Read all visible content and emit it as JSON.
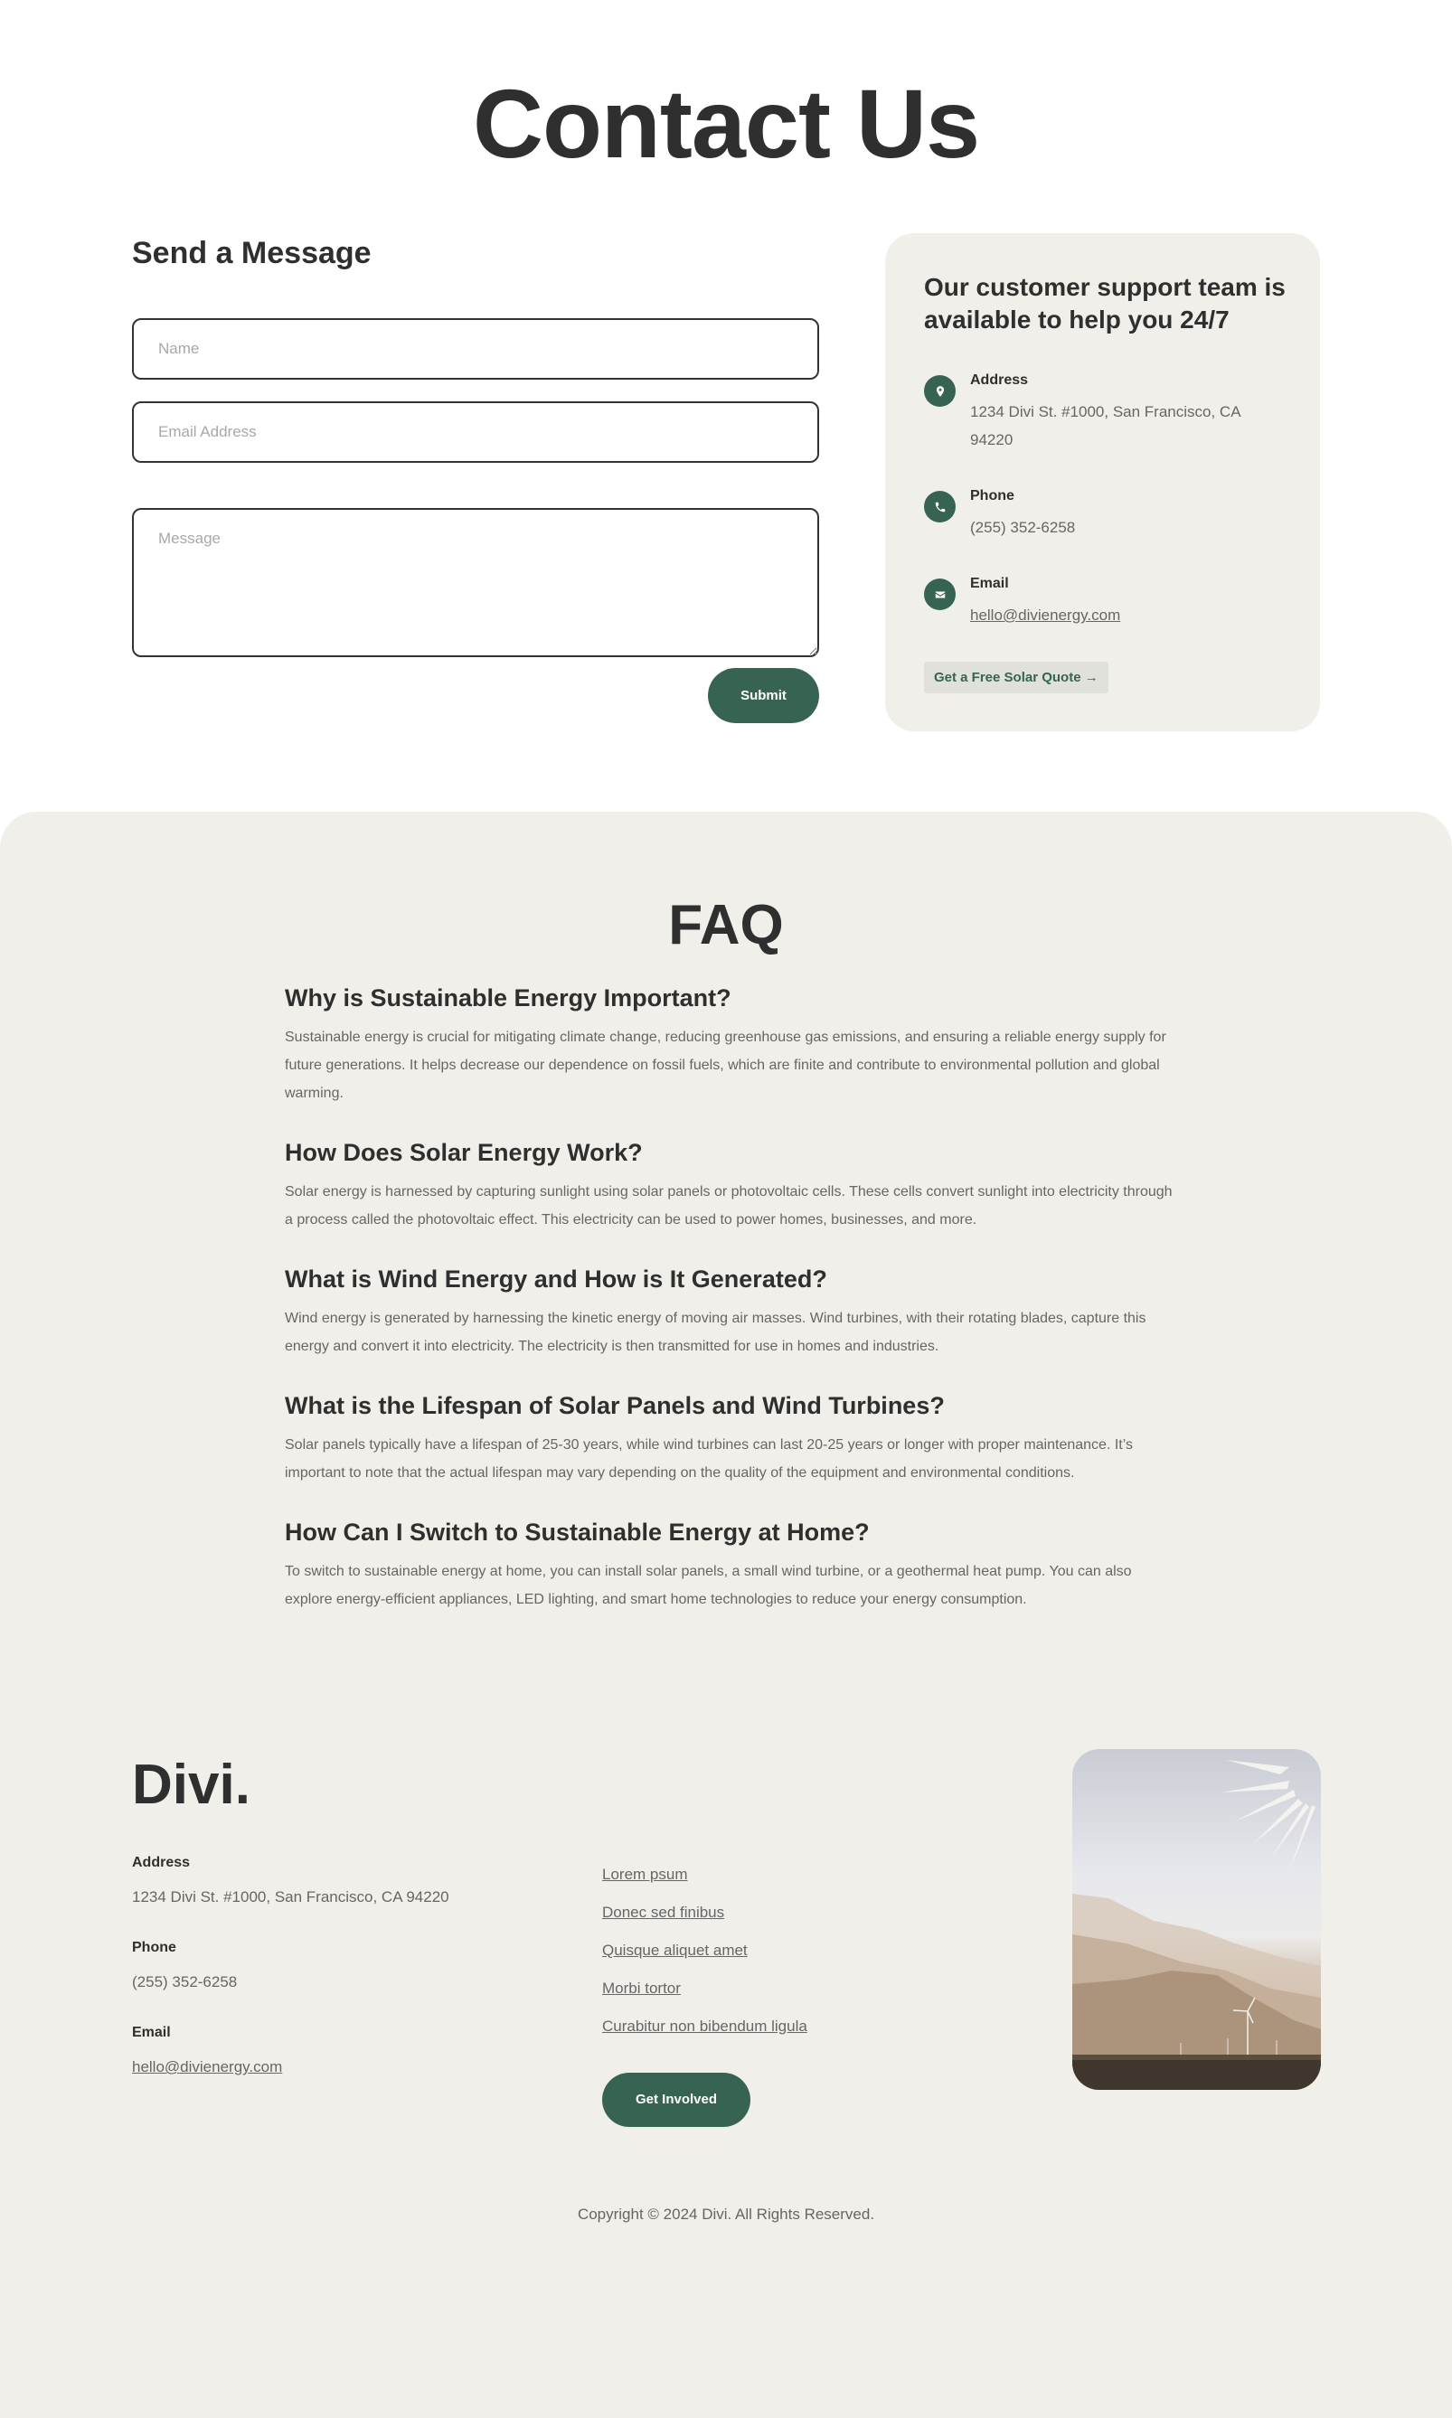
{
  "page": {
    "title": "Contact Us"
  },
  "contact_form": {
    "title": "Send a Message",
    "name_placeholder": "Name",
    "email_placeholder": "Email Address",
    "message_placeholder": "Message",
    "name_value": "",
    "email_value": "",
    "message_value": "",
    "submit_label": "Submit"
  },
  "info_card": {
    "title": "Our customer support team is available to help you 24/7",
    "items": [
      {
        "icon": "map-pin-icon",
        "label": "Address",
        "value": "1234 Divi St. #1000, San Francisco, CA 94220"
      },
      {
        "icon": "phone-icon",
        "label": "Phone",
        "value": "(255) 352-6258"
      },
      {
        "icon": "envelope-icon",
        "label": "Email",
        "value": "hello@divienergy.com"
      }
    ],
    "cta_label": "Get a Free Solar Quote →"
  },
  "faq": {
    "title": "FAQ",
    "items": [
      {
        "question": "Why is Sustainable Energy Important?",
        "answer": "Sustainable energy is crucial for mitigating climate change, reducing greenhouse gas emissions, and ensuring a reliable energy supply for future generations. It helps decrease our dependence on fossil fuels, which are finite and contribute to environmental pollution and global warming."
      },
      {
        "question": "How Does Solar Energy Work?",
        "answer": "Solar energy is harnessed by capturing sunlight using solar panels or photovoltaic cells. These cells convert sunlight into electricity through a process called the photovoltaic effect. This electricity can be used to power homes, businesses, and more."
      },
      {
        "question": "What is Wind Energy and How is It Generated?",
        "answer": "Wind energy is generated by harnessing the kinetic energy of moving air masses. Wind turbines, with their rotating blades, capture this energy and convert it into electricity. The electricity is then transmitted for use in homes and industries."
      },
      {
        "question": "What is the Lifespan of Solar Panels and Wind Turbines?",
        "answer": "Solar panels typically have a lifespan of 25-30 years, while wind turbines can last 20-25 years or longer with proper maintenance. It’s important to note that the actual lifespan may vary depending on the quality of the equipment and environmental conditions."
      },
      {
        "question": "How Can I Switch to Sustainable Energy at Home?",
        "answer": "To switch to sustainable energy at home, you can install solar panels, a small wind turbine, or a geothermal heat pump. You can also explore energy-efficient appliances, LED lighting, and smart home technologies to reduce your energy consumption."
      }
    ]
  },
  "footer": {
    "logo": "Divi.",
    "contact": [
      {
        "label": "Address",
        "value": "1234 Divi St. #1000, San Francisco, CA 94220"
      },
      {
        "label": "Phone",
        "value": "(255) 352-6258"
      },
      {
        "label": "Email",
        "value": "hello@divienergy.com"
      }
    ],
    "links": [
      "Lorem psum",
      "Donec sed finibus",
      "Quisque aliquet amet",
      "Morbi tortor",
      "Curabitur non bibendum ligula"
    ],
    "cta_label": "Get Involved",
    "image_alt": "Wind turbine in hazy desert mountains with sun rays",
    "copyright": "Copyright © 2024 Divi. All Rights Reserved."
  },
  "colors": {
    "accent": "#376452",
    "card_bg": "#f1efe9",
    "heading": "#2f2f2f",
    "body_text": "#666666",
    "quote_button_bg": "#dfe1da"
  }
}
